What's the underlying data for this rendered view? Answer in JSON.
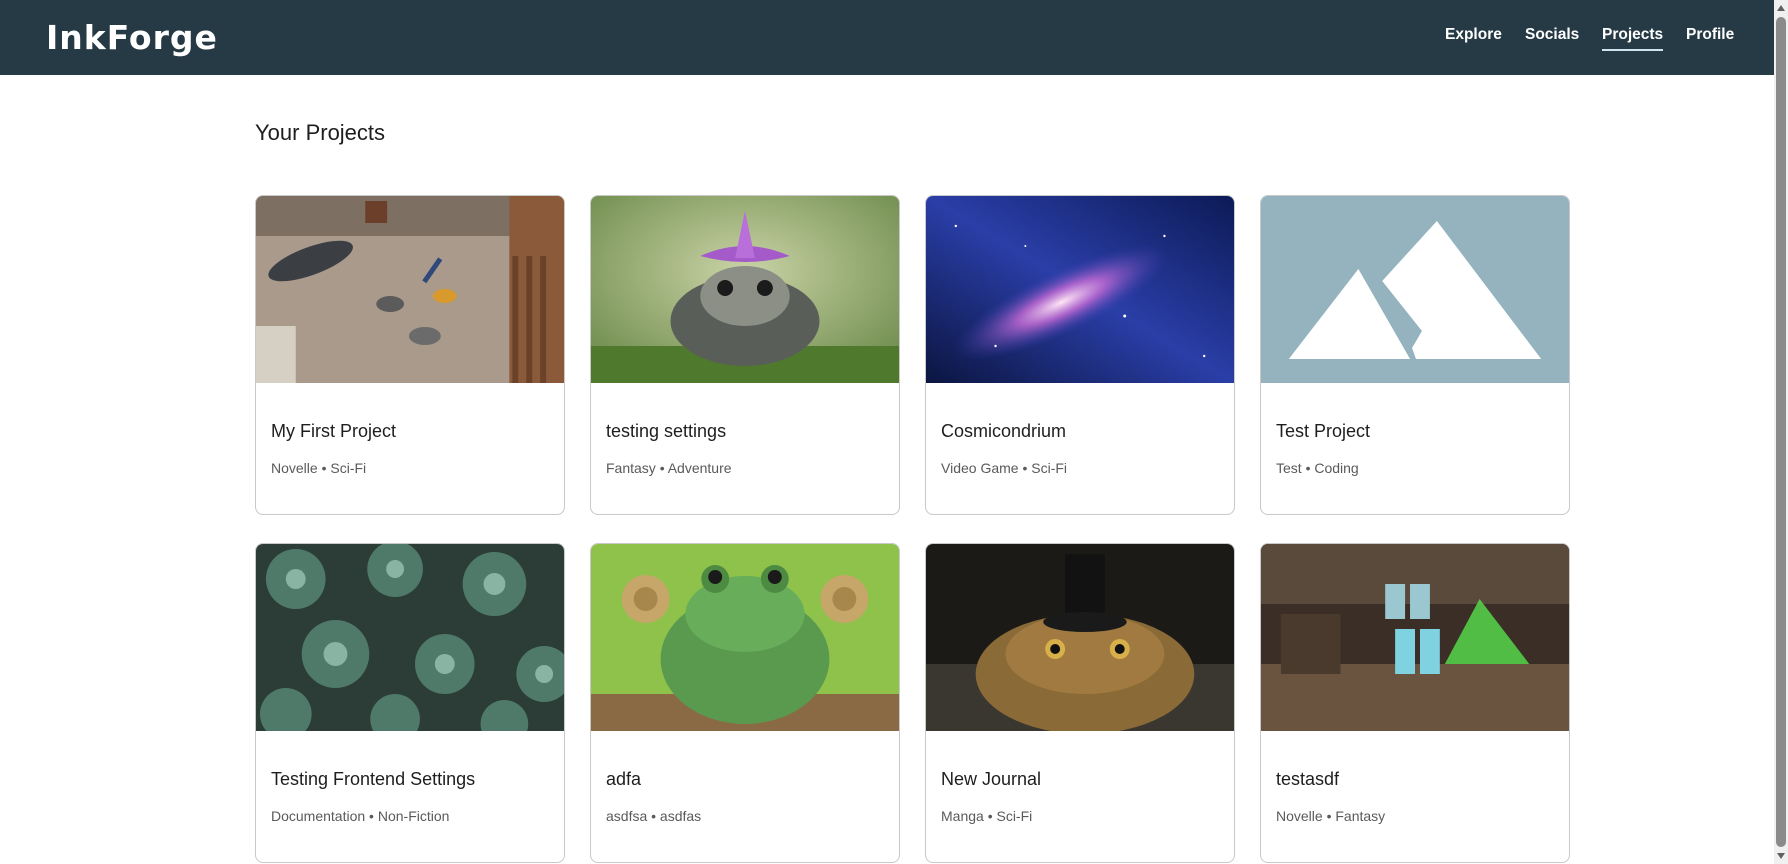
{
  "app": {
    "logo": "InkForge"
  },
  "nav": {
    "items": [
      {
        "label": "Explore"
      },
      {
        "label": "Socials"
      },
      {
        "label": "Projects",
        "active": true
      },
      {
        "label": "Profile"
      }
    ]
  },
  "page": {
    "title": "Your Projects"
  },
  "projects": [
    {
      "title": "My First Project",
      "meta": "Novelle • Sci-Fi",
      "image": "kid-on-floor-with-pixel-items-photo"
    },
    {
      "title": "testing settings",
      "meta": "Fantasy • Adventure",
      "image": "toad-with-flower-hat-photo"
    },
    {
      "title": "Cosmicondrium",
      "meta": "Video Game • Sci-Fi",
      "image": "galaxy-photo"
    },
    {
      "title": "Test Project",
      "meta": "Test • Coding",
      "image": "placeholder-mountain-icon"
    },
    {
      "title": "Testing Frontend Settings",
      "meta": "Documentation • Non-Fiction",
      "image": "succulents-photo"
    },
    {
      "title": "adfa",
      "meta": "asdfsa • asdfas",
      "image": "frog-with-bun-hair-photo"
    },
    {
      "title": "New Journal",
      "meta": "Manga • Sci-Fi",
      "image": "toad-with-top-hat-photo"
    },
    {
      "title": "testasdf",
      "meta": "Novelle • Fantasy",
      "image": "scifi-workshop-photo"
    }
  ],
  "colors": {
    "header_bg": "#263a45",
    "placeholder_bg": "#94b3bf"
  }
}
